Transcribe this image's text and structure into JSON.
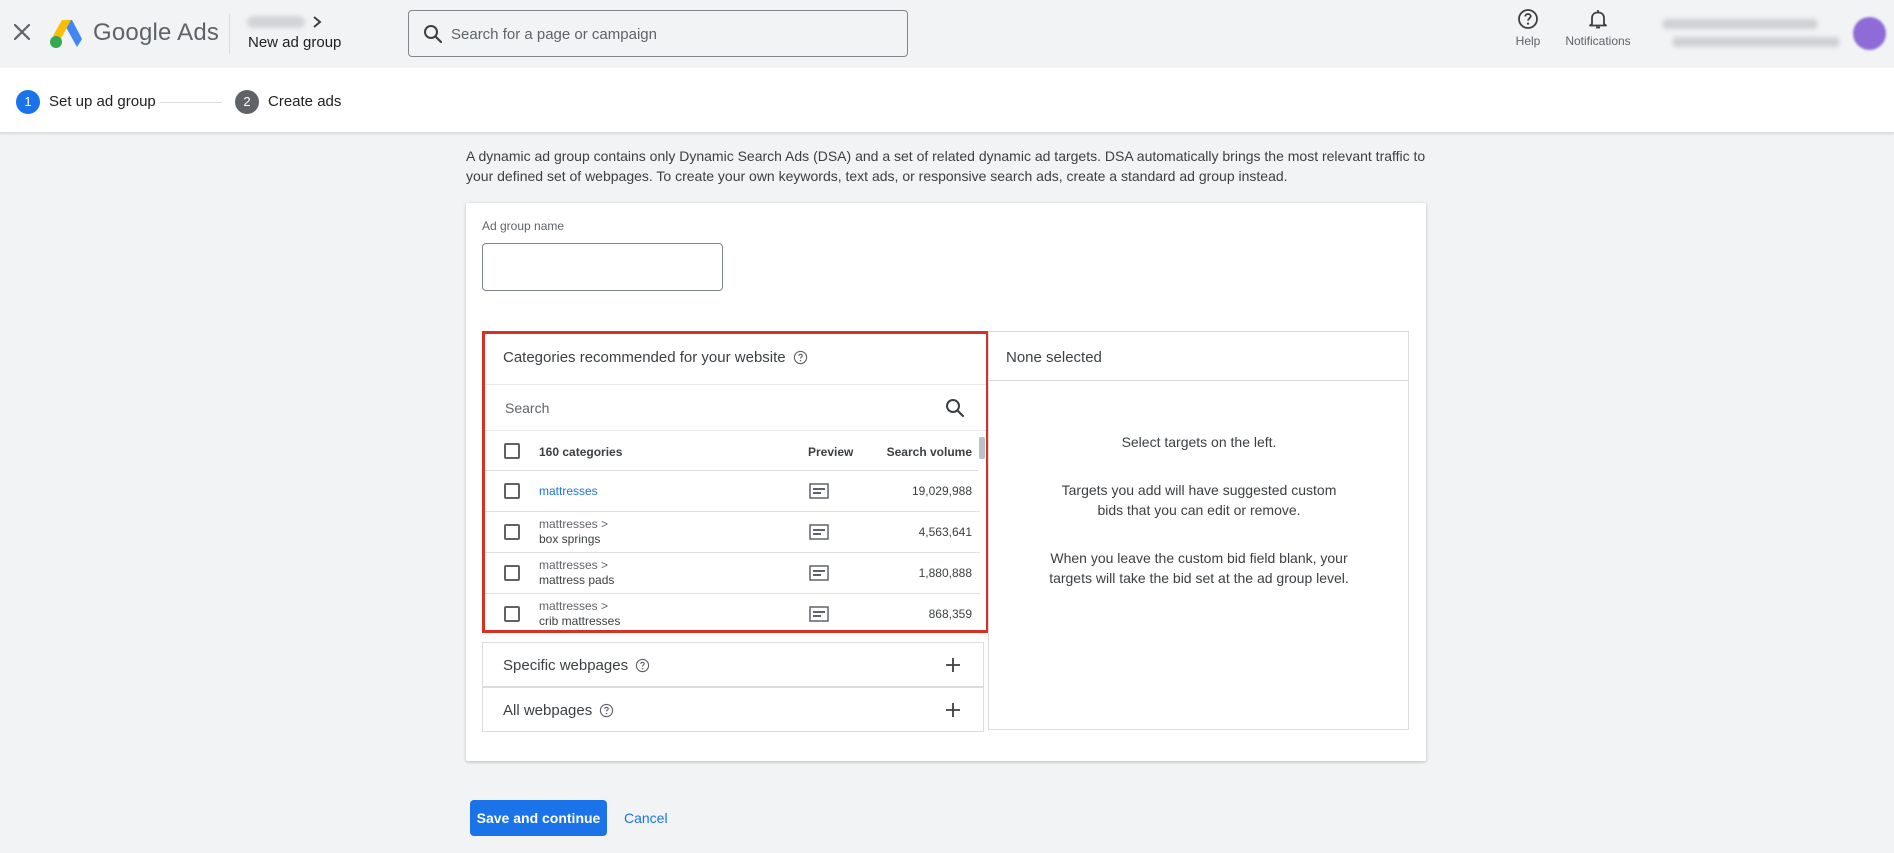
{
  "header": {
    "brand": "Google Ads",
    "page_title": "New ad group",
    "search_placeholder": "Search for a page or campaign",
    "help_label": "Help",
    "notifications_label": "Notifications"
  },
  "stepper": {
    "steps": [
      {
        "number": "1",
        "label": "Set up ad group",
        "active": true
      },
      {
        "number": "2",
        "label": "Create ads",
        "active": false
      }
    ]
  },
  "intro_text": "A dynamic ad group contains only Dynamic Search Ads (DSA) and a set of related dynamic ad targets. DSA automatically brings the most relevant traffic to your defined set of webpages. To create your own keywords, text ads, or responsive search ads, create a standard ad group instead.",
  "form": {
    "ad_group_name_label": "Ad group name",
    "ad_group_name_value": ""
  },
  "categories_panel": {
    "title": "Categories recommended for your website",
    "search_placeholder": "Search",
    "columns": {
      "count": "160 categories",
      "preview": "Preview",
      "volume": "Search volume"
    },
    "rows": [
      {
        "parent": "",
        "name": "mattresses",
        "volume": "19,029,988"
      },
      {
        "parent": "mattresses >",
        "name": "box springs",
        "volume": "4,563,641"
      },
      {
        "parent": "mattresses >",
        "name": "mattress pads",
        "volume": "1,880,888"
      },
      {
        "parent": "mattresses >",
        "name": "crib mattresses",
        "volume": "868,359"
      }
    ]
  },
  "expanders": [
    {
      "label": "Specific webpages"
    },
    {
      "label": "All webpages"
    }
  ],
  "selection_panel": {
    "title": "None selected",
    "messages": [
      "Select targets on the left.",
      "Targets you add will have suggested custom bids that you can edit or remove.",
      "When you leave the custom bid field blank, your targets will take the bid set at the ad group level."
    ]
  },
  "footer": {
    "save_label": "Save and continue",
    "cancel_label": "Cancel"
  },
  "colors": {
    "primary": "#1a73e8",
    "highlight_border": "#d93025"
  }
}
